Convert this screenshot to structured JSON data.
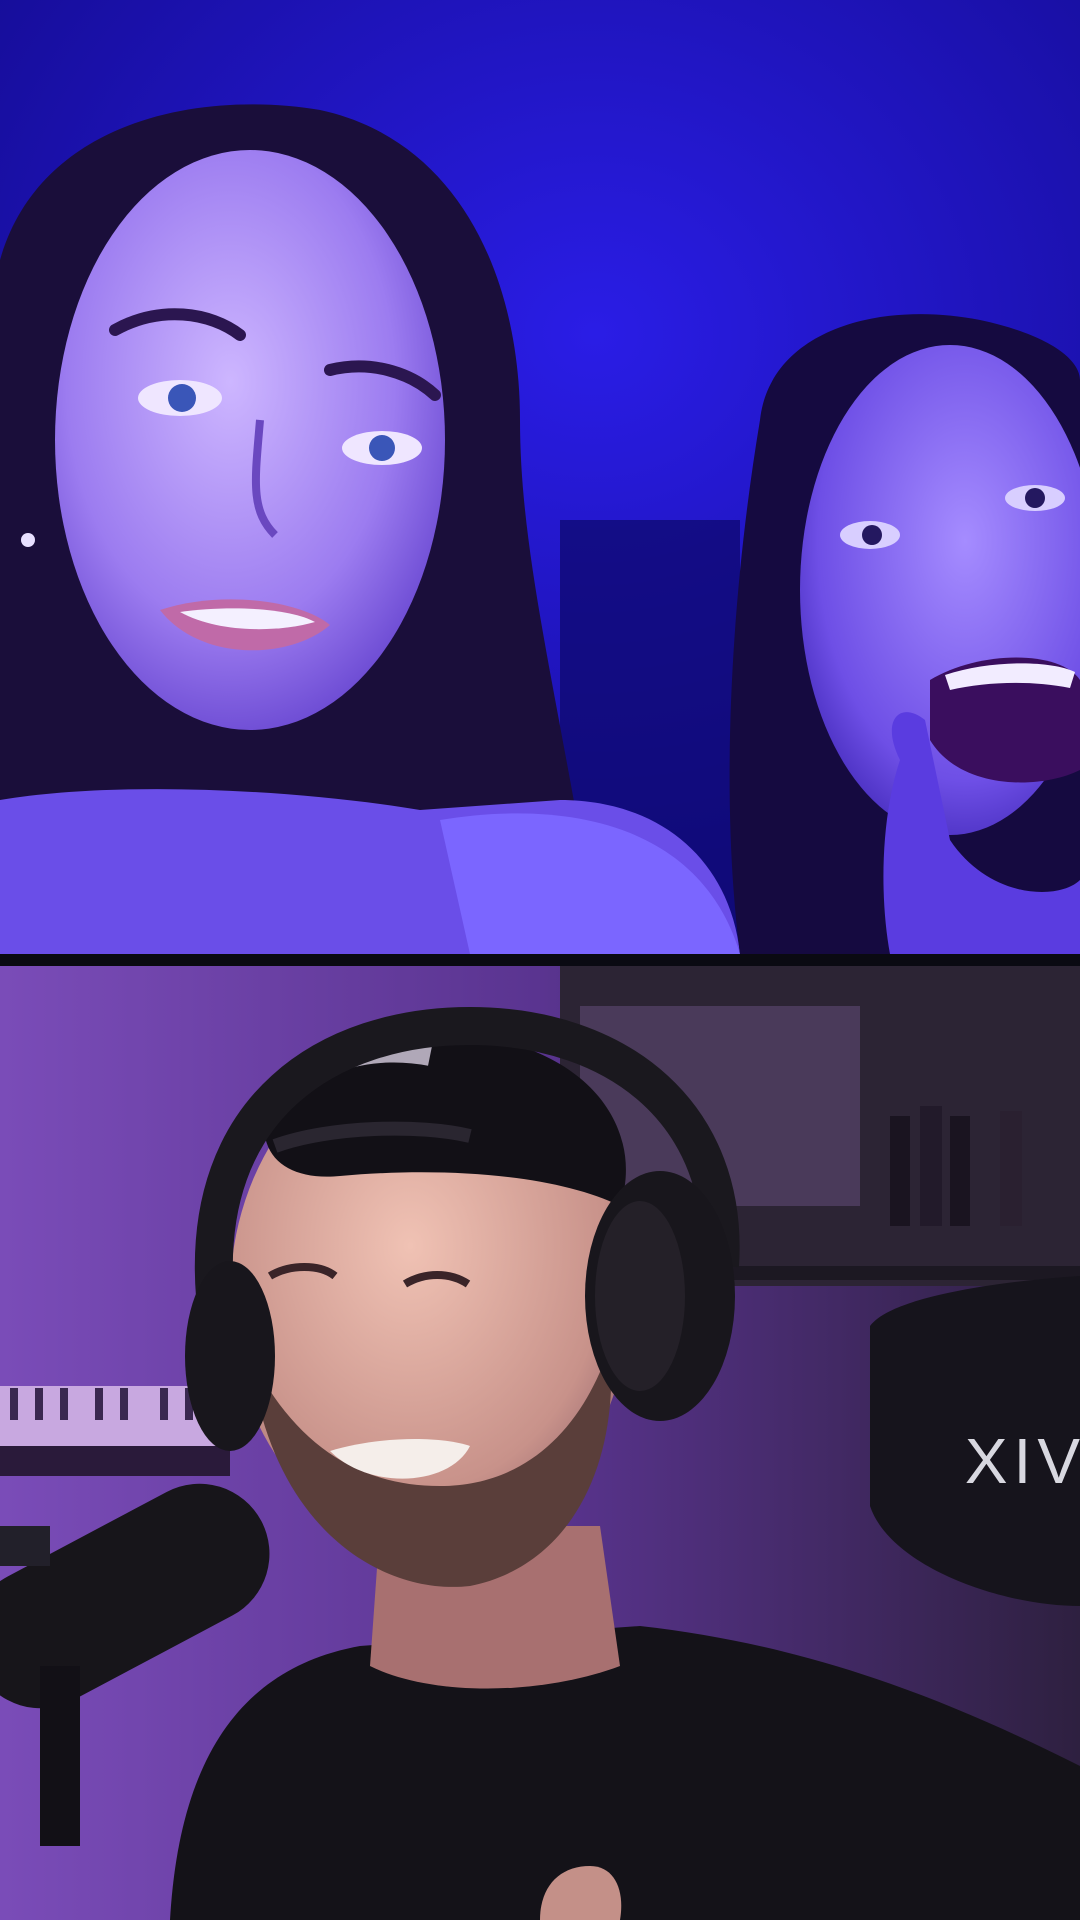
{
  "scene": {
    "layout": "split-screen-video-call",
    "top_panel": {
      "subject": "two-women-webcam",
      "lighting_color": "#2b1ee0"
    },
    "bottom_panel": {
      "subject": "man-with-headphones-and-microphone",
      "lighting_color": "#6a3aa8"
    }
  },
  "chair": {
    "brand_text": "XIV"
  }
}
